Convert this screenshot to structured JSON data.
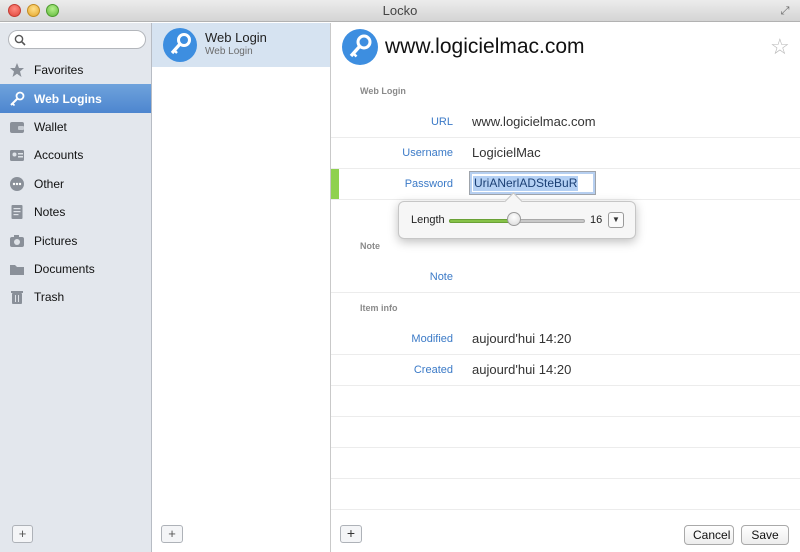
{
  "window": {
    "title": "Locko"
  },
  "search": {
    "placeholder": "",
    "value": ""
  },
  "sidebar": {
    "items": [
      {
        "label": "Favorites",
        "icon": "star-icon",
        "active": false
      },
      {
        "label": "Web Logins",
        "icon": "key-icon",
        "active": true
      },
      {
        "label": "Wallet",
        "icon": "wallet-icon",
        "active": false
      },
      {
        "label": "Accounts",
        "icon": "id-card-icon",
        "active": false
      },
      {
        "label": "Other",
        "icon": "other-icon",
        "active": false
      },
      {
        "label": "Notes",
        "icon": "note-icon",
        "active": false
      },
      {
        "label": "Pictures",
        "icon": "camera-icon",
        "active": false
      },
      {
        "label": "Documents",
        "icon": "folder-icon",
        "active": false
      },
      {
        "label": "Trash",
        "icon": "trash-icon",
        "active": false
      }
    ],
    "add_label": "+"
  },
  "list": {
    "items": [
      {
        "title": "Web Login",
        "subtitle": "Web Login",
        "selected": true
      }
    ],
    "add_label": "+"
  },
  "detail": {
    "title": "www.logicielmac.com",
    "sections": {
      "web_login": "Web Login",
      "note": "Note",
      "item_info": "Item info"
    },
    "fields": {
      "url": {
        "label": "URL",
        "value": "www.logicielmac.com"
      },
      "username": {
        "label": "Username",
        "value": "LogicielMac"
      },
      "password": {
        "label": "Password",
        "value": "UriANerlADSteBuR"
      },
      "note": {
        "label": "Note",
        "value": ""
      },
      "modified": {
        "label": "Modified",
        "value": "aujourd'hui 14:20"
      },
      "created": {
        "label": "Created",
        "value": "aujourd'hui 14:20"
      }
    },
    "generator": {
      "label": "Length",
      "value": "16",
      "level_fraction": 0.48
    },
    "buttons": {
      "add": "+",
      "cancel": "Cancel",
      "save": "Save"
    }
  },
  "colors": {
    "accent": "#4d86cf",
    "label_blue": "#3b7ac7",
    "strength_green": "#8fd14f",
    "icon_blue": "#3d8ee0"
  }
}
